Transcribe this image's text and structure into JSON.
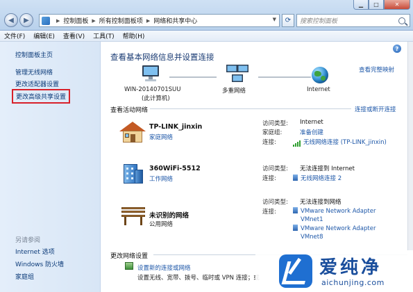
{
  "address_bar": {
    "crumbs": [
      "控制面板",
      "所有控制面板项",
      "网络和共享中心"
    ]
  },
  "search": {
    "placeholder": "搜索控制面板"
  },
  "menu": [
    "文件(F)",
    "编辑(E)",
    "查看(V)",
    "工具(T)",
    "帮助(H)"
  ],
  "sidebar": {
    "home": "控制面板主页",
    "links": [
      "管理无线网络",
      "更改适配器设置",
      "更改高级共享设置"
    ],
    "see_also_header": "另请参阅",
    "see_also": [
      "Internet 选项",
      "Windows 防火墙",
      "家庭组"
    ]
  },
  "main": {
    "title": "查看基本网络信息并设置连接",
    "full_map_link": "查看完整映射",
    "map": {
      "computer_name": "WIN-20140701SUU",
      "computer_sub": "(此计算机)",
      "middle": "多重网络",
      "internet": "Internet"
    },
    "active_title": "查看活动网络",
    "connect_link": "连接或断开连接",
    "networks": [
      {
        "name": "TP-LINK_jinxin",
        "type": "家庭网络",
        "access_key": "访问类型:",
        "access_val": "Internet",
        "group_key": "家庭组:",
        "group_val": "准备创建",
        "conn_key": "连接:",
        "conn_val": "无线网络连接 (TP-LINK_jinxin)"
      },
      {
        "name": "360WiFi-5512",
        "type": "工作网络",
        "access_key": "访问类型:",
        "access_val": "无法连接到 Internet",
        "conn_key": "连接:",
        "conn_val": "无线网络连接 2"
      },
      {
        "name": "未识别的网络",
        "type": "公用网络",
        "access_key": "访问类型:",
        "access_val": "无法连接到网络",
        "conn_key": "连接:",
        "conn_val_1a": "VMware Network Adapter",
        "conn_val_1b": "VMnet1",
        "conn_val_2a": "VMware Network Adapter",
        "conn_val_2b": "VMnet8"
      }
    ],
    "change_title": "更改网络设置",
    "change_link": "设置新的连接或网络",
    "change_desc": "设置无线、宽带、拨号、临时或 VPN 连接；或"
  },
  "watermark": {
    "name": "爱纯净",
    "url": "aichunjing.com"
  }
}
